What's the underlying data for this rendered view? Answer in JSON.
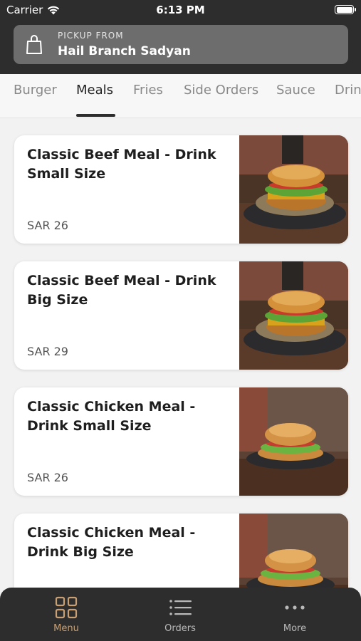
{
  "status_bar": {
    "carrier": "Carrier",
    "time": "6:13 PM"
  },
  "pickup": {
    "label": "PICKUP FROM",
    "branch": "Hail Branch Sadyan",
    "icon": "shopping-bag-icon"
  },
  "tabs": [
    {
      "label": "Burger",
      "active": false
    },
    {
      "label": "Meals",
      "active": true
    },
    {
      "label": "Fries",
      "active": false
    },
    {
      "label": "Side Orders",
      "active": false
    },
    {
      "label": "Sauce",
      "active": false
    },
    {
      "label": "Drinks",
      "active": false
    }
  ],
  "items": [
    {
      "title": "Classic Beef Meal - Drink Small Size",
      "price": "SAR 26",
      "image": "beef-burger-photo"
    },
    {
      "title": "Classic Beef Meal - Drink Big Size",
      "price": "SAR 29",
      "image": "beef-burger-photo"
    },
    {
      "title": "Classic Chicken Meal - Drink Small Size",
      "price": "SAR 26",
      "image": "chicken-burger-photo"
    },
    {
      "title": "Classic Chicken Meal - Drink Big Size",
      "price": "",
      "image": "chicken-burger-photo"
    }
  ],
  "bottom_nav": [
    {
      "label": "Menu",
      "icon": "grid-icon",
      "active": true
    },
    {
      "label": "Orders",
      "icon": "list-icon",
      "active": false
    },
    {
      "label": "More",
      "icon": "more-dots-icon",
      "active": false
    }
  ],
  "colors": {
    "header_bg": "#2d2d2d",
    "accent": "#c8a074",
    "pickup_bg": "#6d6d6d"
  }
}
